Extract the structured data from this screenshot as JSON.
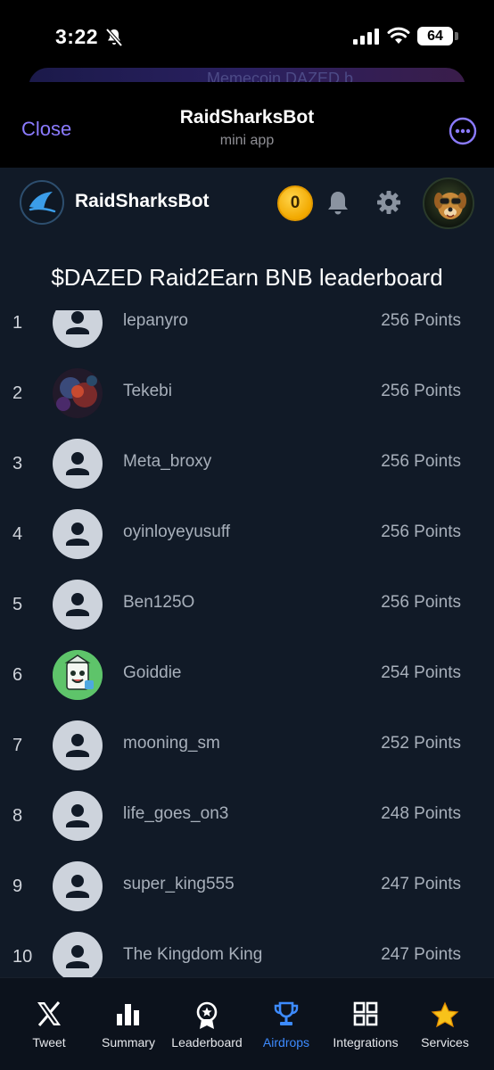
{
  "status_bar": {
    "time": "3:22",
    "battery": "64"
  },
  "background_peek": {
    "text": "Memecoin DAZED b"
  },
  "miniapp": {
    "close_label": "Close",
    "title": "RaidSharksBot",
    "subtitle": "mini app"
  },
  "app": {
    "brand": "RaidSharksBot",
    "coins": "0"
  },
  "leaderboard": {
    "title": "$DAZED Raid2Earn BNB leaderboard",
    "rows": [
      {
        "rank": "1",
        "name": "lepanyro",
        "points": "256 Points"
      },
      {
        "rank": "2",
        "name": "Tekebi",
        "points": "256 Points"
      },
      {
        "rank": "3",
        "name": "Meta_broxy",
        "points": "256 Points"
      },
      {
        "rank": "4",
        "name": "oyinloyeyusuff",
        "points": "256 Points"
      },
      {
        "rank": "5",
        "name": "Ben125O",
        "points": "256 Points"
      },
      {
        "rank": "6",
        "name": "Goiddie",
        "points": "254 Points"
      },
      {
        "rank": "7",
        "name": "mooning_sm",
        "points": "252 Points"
      },
      {
        "rank": "8",
        "name": "life_goes_on3",
        "points": "248 Points"
      },
      {
        "rank": "9",
        "name": "super_king555",
        "points": "247 Points"
      },
      {
        "rank": "10",
        "name": "The Kingdom King",
        "points": "247 Points"
      }
    ]
  },
  "nav": {
    "items": [
      {
        "label": "Tweet",
        "icon": "x-logo-icon"
      },
      {
        "label": "Summary",
        "icon": "bar-chart-icon"
      },
      {
        "label": "Leaderboard",
        "icon": "medal-icon"
      },
      {
        "label": "Airdrops",
        "icon": "trophy-icon"
      },
      {
        "label": "Integrations",
        "icon": "grid-icon"
      },
      {
        "label": "Services",
        "icon": "star-icon"
      }
    ],
    "active": "Airdrops"
  },
  "colors": {
    "accent": "#3d8bff",
    "close": "#8b7bff",
    "background": "#111a27",
    "coin": "#f2a900"
  }
}
